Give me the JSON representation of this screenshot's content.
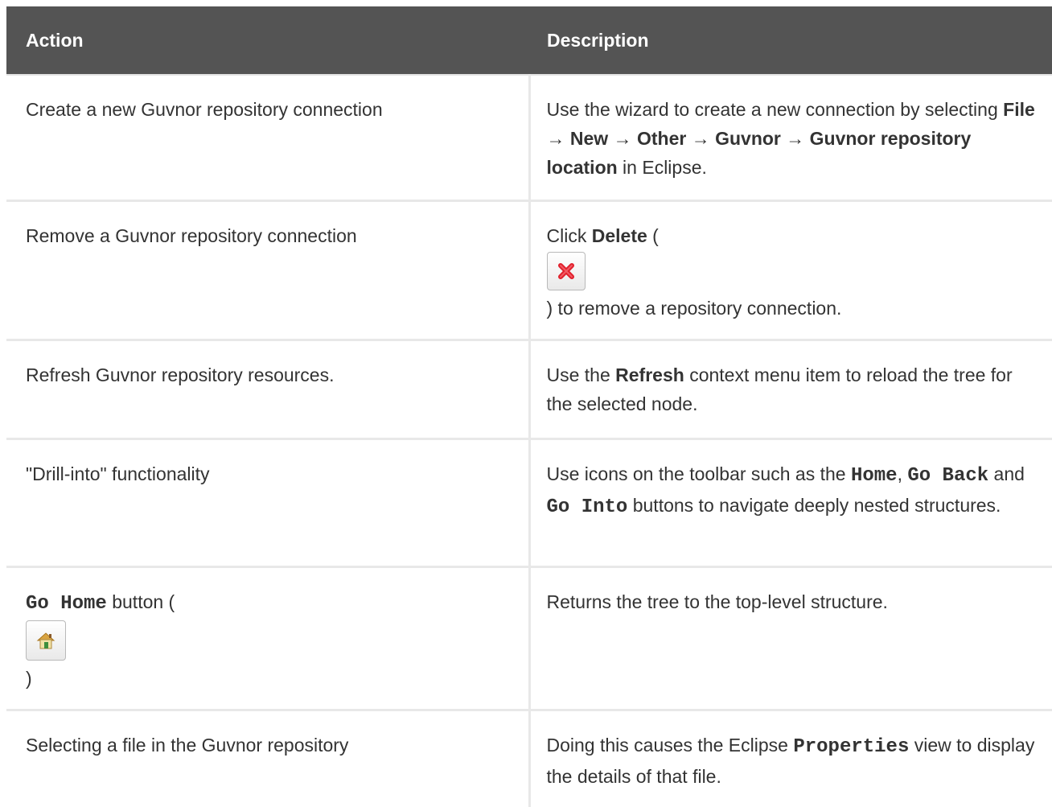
{
  "header": {
    "action": "Action",
    "description": "Description"
  },
  "rows": [
    {
      "action": "Create a new Guvnor repository connection",
      "desc": {
        "t1": "Use the wizard to create a new connection by selecting ",
        "b1": "File",
        "a1": " → ",
        "b2": "New",
        "a2": " → ",
        "b3": "Other",
        "a3": " → ",
        "b4": "Guvnor",
        "a4": " → ",
        "b5": "Guvnor repository location",
        "t2": " in Eclipse."
      }
    },
    {
      "action": "Remove a Guvnor repository connection",
      "desc": {
        "t1": "Click ",
        "b1": "Delete",
        "t2": " (",
        "icon": "delete-x-icon",
        "t3": ") to remove a repository connection."
      }
    },
    {
      "action": "Refresh Guvnor repository resources.",
      "desc": {
        "t1": "Use the ",
        "b1": "Refresh",
        "t2": " context menu item to reload the tree for the selected node."
      }
    },
    {
      "action": "\"Drill-into\" functionality",
      "desc": {
        "t1": "Use icons on the toolbar such as the ",
        "m1": "Home",
        "t2": ", ",
        "m2": "Go Back",
        "t3": " and ",
        "m3": "Go Into",
        "t4": " buttons to navigate deeply nested structures."
      }
    },
    {
      "action": {
        "m1": "Go Home",
        "t1": " button (",
        "icon": "home-icon",
        "t2": ")"
      },
      "desc": "Returns the tree to the top-level structure."
    },
    {
      "action": "Selecting a file in the Guvnor repository",
      "desc": {
        "t1": "Doing this causes the Eclipse ",
        "m1": "Properties",
        "t2": " view to display the details of that file."
      }
    }
  ],
  "colors": {
    "header_bg": "#545454",
    "header_text": "#ffffff",
    "body_text": "#333333",
    "grid": "#e8e8e8",
    "delete_icon_red": "#e0202c"
  }
}
